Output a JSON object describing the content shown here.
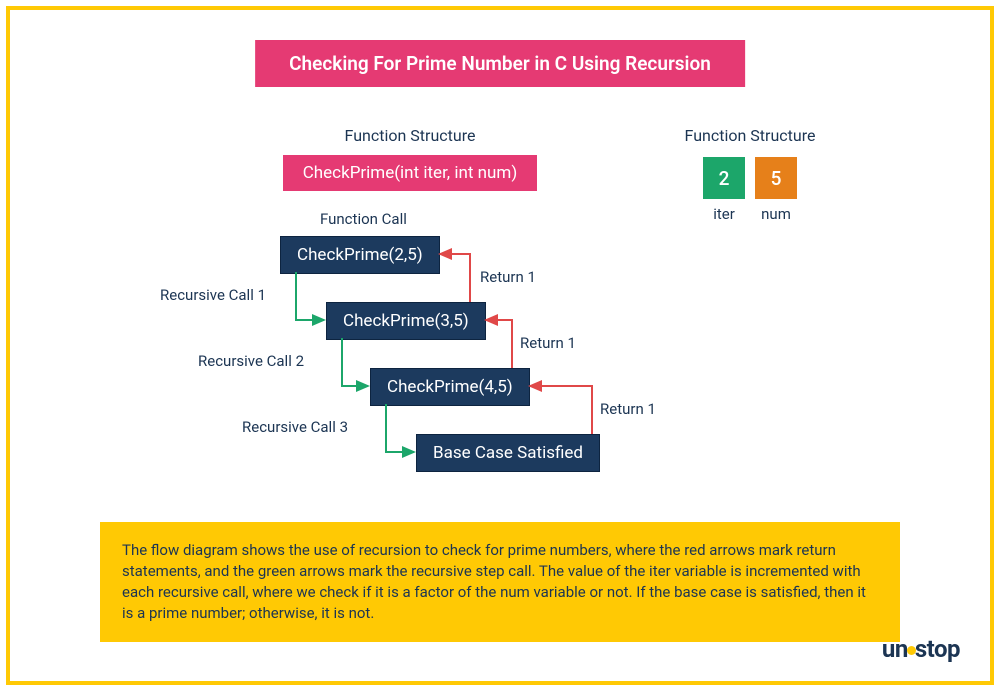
{
  "title": "Checking For Prime Number in C Using Recursion",
  "left_section": {
    "label": "Function Structure",
    "signature": "CheckPrime(int iter, int num)"
  },
  "right_section": {
    "label": "Function Structure",
    "iter_value": "2",
    "num_value": "5",
    "iter_label": "iter",
    "num_label": "num"
  },
  "diagram": {
    "function_call_label": "Function Call",
    "nodes": {
      "n1": "CheckPrime(2,5)",
      "n2": "CheckPrime(3,5)",
      "n3": "CheckPrime(4,5)",
      "n4": "Base Case Satisfied"
    },
    "rec_labels": {
      "r1": "Recursive Call 1",
      "r2": "Recursive Call 2",
      "r3": "Recursive Call 3"
    },
    "ret_labels": {
      "ret1": "Return 1",
      "ret2": "Return 1",
      "ret3": "Return 1"
    }
  },
  "description": "The flow diagram shows the use of recursion to check for prime numbers, where the red arrows mark return statements, and the green arrows mark the recursive step call. The value of the iter variable is incremented with each recursive call, where we check if it is a factor of the num variable or not. If the base case is satisfied, then it is a prime number; otherwise, it is not.",
  "logo": {
    "part1": "un",
    "part2": "stop"
  }
}
